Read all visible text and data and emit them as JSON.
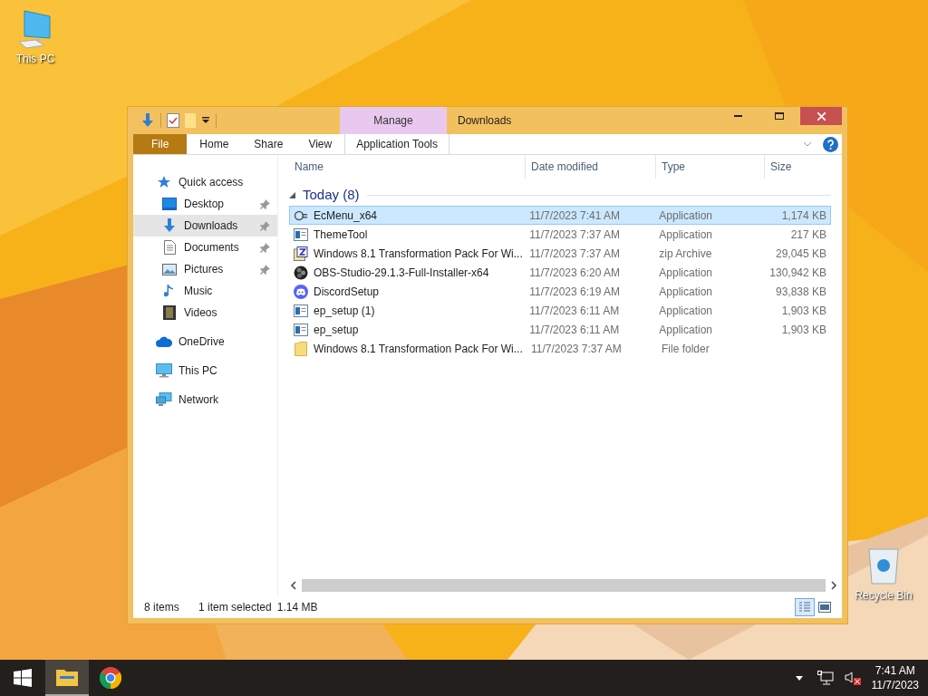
{
  "desktop_icons": [
    {
      "label": "This PC",
      "kind": "pc"
    },
    {
      "label": "Recycle Bin",
      "kind": "bin"
    }
  ],
  "window": {
    "title": "Downloads",
    "contextual_group": "Manage",
    "tabs": [
      {
        "label": "File",
        "kind": "file",
        "selected": false
      },
      {
        "label": "Home",
        "kind": "tab",
        "selected": false
      },
      {
        "label": "Share",
        "kind": "tab",
        "selected": false
      },
      {
        "label": "View",
        "kind": "tab",
        "selected": false
      },
      {
        "label": "Application Tools",
        "kind": "context",
        "selected": false
      }
    ],
    "nav": [
      {
        "label": "Quick access",
        "kind": "star",
        "selected": false,
        "children": [
          {
            "label": "Desktop",
            "kind": "desktop",
            "selected": false,
            "pinned": true
          },
          {
            "label": "Downloads",
            "kind": "downloads",
            "selected": true,
            "pinned": true
          },
          {
            "label": "Documents",
            "kind": "documents",
            "selected": false,
            "pinned": true
          },
          {
            "label": "Pictures",
            "kind": "pictures",
            "selected": false,
            "pinned": true
          },
          {
            "label": "Music",
            "kind": "music",
            "selected": false,
            "pinned": false
          },
          {
            "label": "Videos",
            "kind": "videos",
            "selected": false,
            "pinned": false
          }
        ]
      },
      {
        "label": "OneDrive",
        "kind": "cloud",
        "selected": false
      },
      {
        "label": "This PC",
        "kind": "pc",
        "selected": false
      },
      {
        "label": "Network",
        "kind": "network",
        "selected": false
      }
    ],
    "columns": [
      "Name",
      "Date modified",
      "Type",
      "Size"
    ],
    "group": {
      "label": "Today (8)",
      "expanded": true
    },
    "rows": [
      {
        "name": "EcMenu_x64",
        "date": "11/7/2023 7:41 AM",
        "type": "Application",
        "size": "1,174 KB",
        "kind": "ecmenu",
        "selected": true
      },
      {
        "name": "ThemeTool",
        "date": "11/7/2023 7:37 AM",
        "type": "Application",
        "size": "217 KB",
        "kind": "app",
        "selected": false
      },
      {
        "name": "Windows 8.1 Transformation Pack For Wi...",
        "date": "11/7/2023 7:37 AM",
        "type": "zip Archive",
        "size": "29,045 KB",
        "kind": "zip",
        "selected": false
      },
      {
        "name": "OBS-Studio-29.1.3-Full-Installer-x64",
        "date": "11/7/2023 6:20 AM",
        "type": "Application",
        "size": "130,942 KB",
        "kind": "obs",
        "selected": false
      },
      {
        "name": "DiscordSetup",
        "date": "11/7/2023 6:19 AM",
        "type": "Application",
        "size": "93,838 KB",
        "kind": "discord",
        "selected": false
      },
      {
        "name": "ep_setup (1)",
        "date": "11/7/2023 6:11 AM",
        "type": "Application",
        "size": "1,903 KB",
        "kind": "app",
        "selected": false
      },
      {
        "name": "ep_setup",
        "date": "11/7/2023 6:11 AM",
        "type": "Application",
        "size": "1,903 KB",
        "kind": "app",
        "selected": false
      },
      {
        "name": "Windows 8.1 Transformation Pack For Wi...",
        "date": "11/7/2023 7:37 AM",
        "type": "File folder",
        "size": "",
        "kind": "folder",
        "selected": false
      }
    ],
    "status": {
      "count": "8 items",
      "selection": "1 item selected",
      "size": "1.14 MB"
    },
    "views": [
      {
        "kind": "details",
        "selected": true
      },
      {
        "kind": "tiles",
        "selected": false
      }
    ]
  },
  "taskbar": {
    "apps": [
      {
        "kind": "explorer",
        "selected": true
      },
      {
        "kind": "chrome",
        "selected": false
      }
    ],
    "time": "7:41 AM",
    "date": "11/7/2023"
  }
}
